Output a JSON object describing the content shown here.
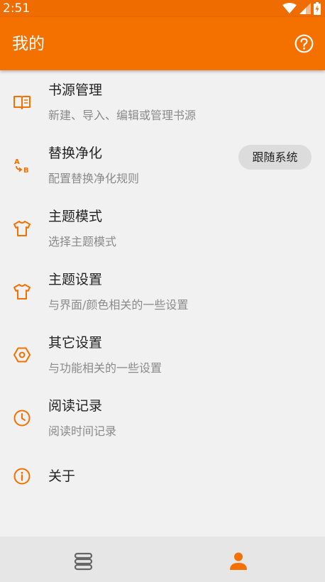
{
  "status_bar": {
    "time": "2:51",
    "icons": [
      "wifi-icon",
      "cellular-signal-icon",
      "battery-icon"
    ]
  },
  "app_bar": {
    "title": "我的",
    "help_icon": "help-circle-icon"
  },
  "menu": {
    "items": [
      {
        "icon": "book-icon",
        "title": "书源管理",
        "subtitle": "新建、导入、编辑或管理书源"
      },
      {
        "icon": "replace-icon",
        "title": "替换净化",
        "subtitle": "配置替换净化规则"
      },
      {
        "icon": "shirt-icon",
        "title": "主题模式",
        "subtitle": "选择主题模式",
        "value": "跟随系统"
      },
      {
        "icon": "shirt-icon",
        "title": "主题设置",
        "subtitle": "与界面/颜色相关的一些设置"
      },
      {
        "icon": "hexagon-settings-icon",
        "title": "其它设置",
        "subtitle": "与功能相关的一些设置"
      },
      {
        "icon": "clock-icon",
        "title": "阅读记录",
        "subtitle": "阅读时间记录"
      },
      {
        "icon": "info-icon",
        "title": "关于"
      }
    ]
  },
  "bottom_nav": {
    "items": [
      {
        "icon": "bookshelf-icon",
        "active": false
      },
      {
        "icon": "person-icon",
        "active": true
      }
    ]
  },
  "colors": {
    "accent": "#f47100",
    "status_bar": "#ee6c00",
    "background": "#f1f1f1",
    "bottom_nav": "#e6e6e6",
    "inactive_icon": "#666666"
  }
}
